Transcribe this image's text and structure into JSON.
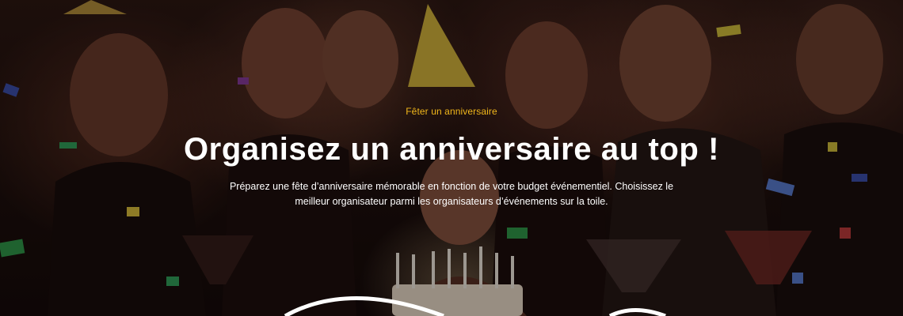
{
  "hero": {
    "eyebrow": "Fêter un anniversaire",
    "title": "Organisez un anniversaire au top !",
    "subtitle": "Préparez une fête d’anniversaire mémorable en fonction de votre budget événementiel. Choisissez le meilleur organisateur parmi les organisateurs d’événements sur la toile.",
    "background_image": "birthday-party-photo"
  },
  "colors": {
    "accent": "#f1b71b",
    "text": "#ffffff",
    "overlay": "#080404"
  }
}
